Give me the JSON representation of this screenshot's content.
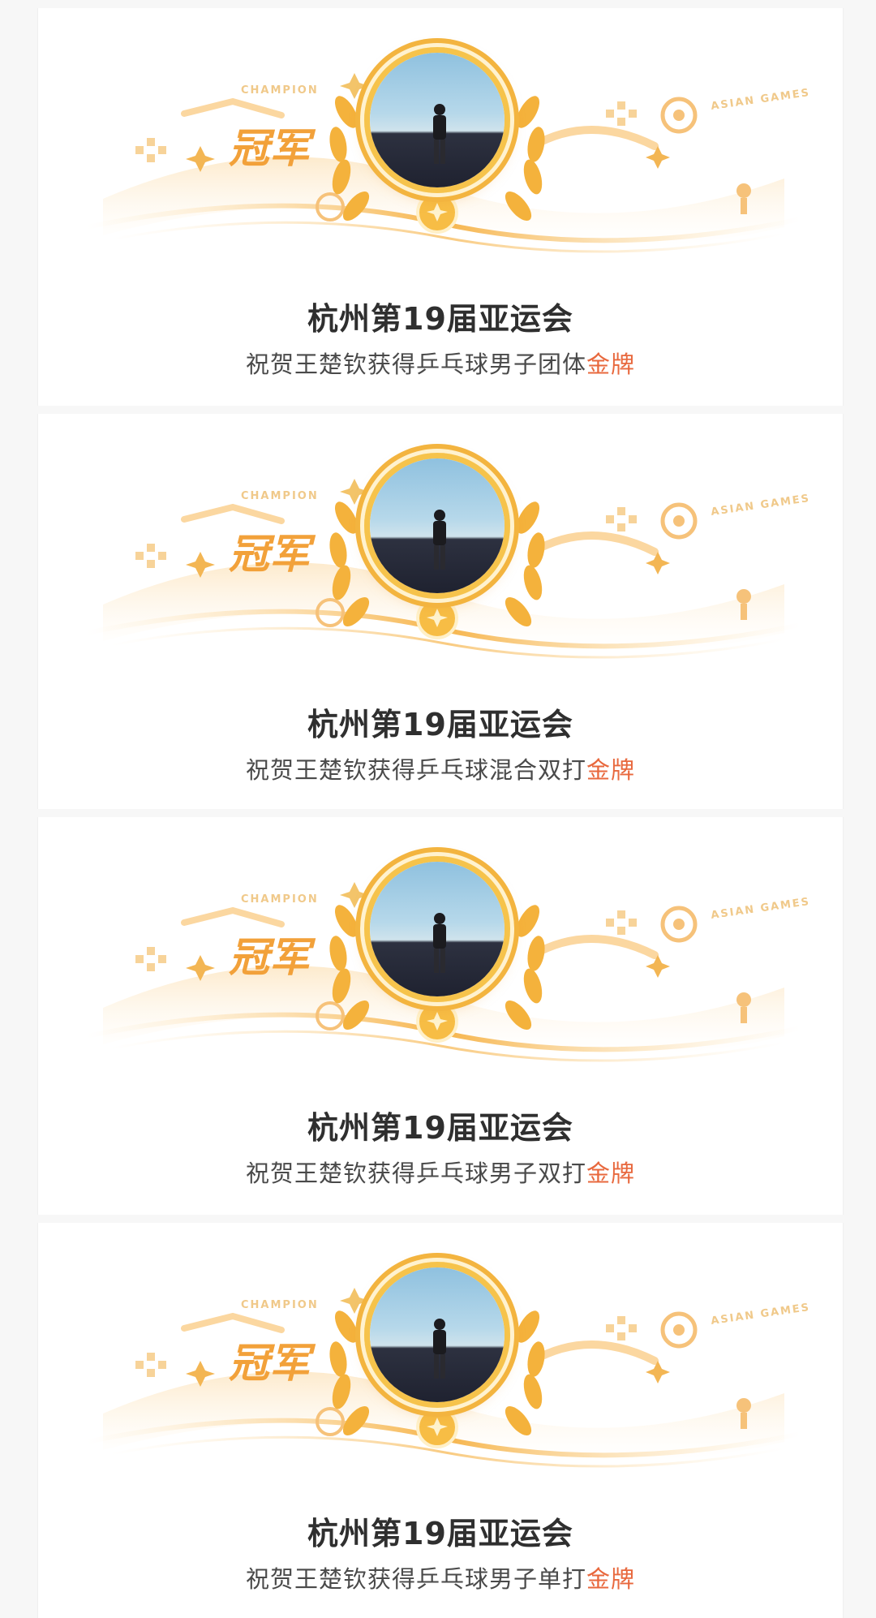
{
  "cards": [
    {
      "banner": {
        "champion_label": "CHAMPION",
        "asian_games_label": "ASIAN GAMES",
        "crown_text": "冠军"
      },
      "title": "杭州第19届亚运会",
      "subtitle_prefix": "祝贺王楚钦获得乒乓球男子团体",
      "subtitle_highlight": "金牌"
    },
    {
      "banner": {
        "champion_label": "CHAMPION",
        "asian_games_label": "ASIAN GAMES",
        "crown_text": "冠军"
      },
      "title": "杭州第19届亚运会",
      "subtitle_prefix": "祝贺王楚钦获得乒乓球混合双打",
      "subtitle_highlight": "金牌"
    },
    {
      "banner": {
        "champion_label": "CHAMPION",
        "asian_games_label": "ASIAN GAMES",
        "crown_text": "冠军"
      },
      "title": "杭州第19届亚运会",
      "subtitle_prefix": "祝贺王楚钦获得乒乓球男子双打",
      "subtitle_highlight": "金牌"
    },
    {
      "banner": {
        "champion_label": "CHAMPION",
        "asian_games_label": "ASIAN GAMES",
        "crown_text": "冠军"
      },
      "title": "杭州第19届亚运会",
      "subtitle_prefix": "祝贺王楚钦获得乒乓球男子单打",
      "subtitle_highlight": "金牌"
    }
  ],
  "colors": {
    "gold_accent": "#e8683d",
    "banner_gold": "#f2a13a",
    "medal_ring": "#f6c34b"
  }
}
